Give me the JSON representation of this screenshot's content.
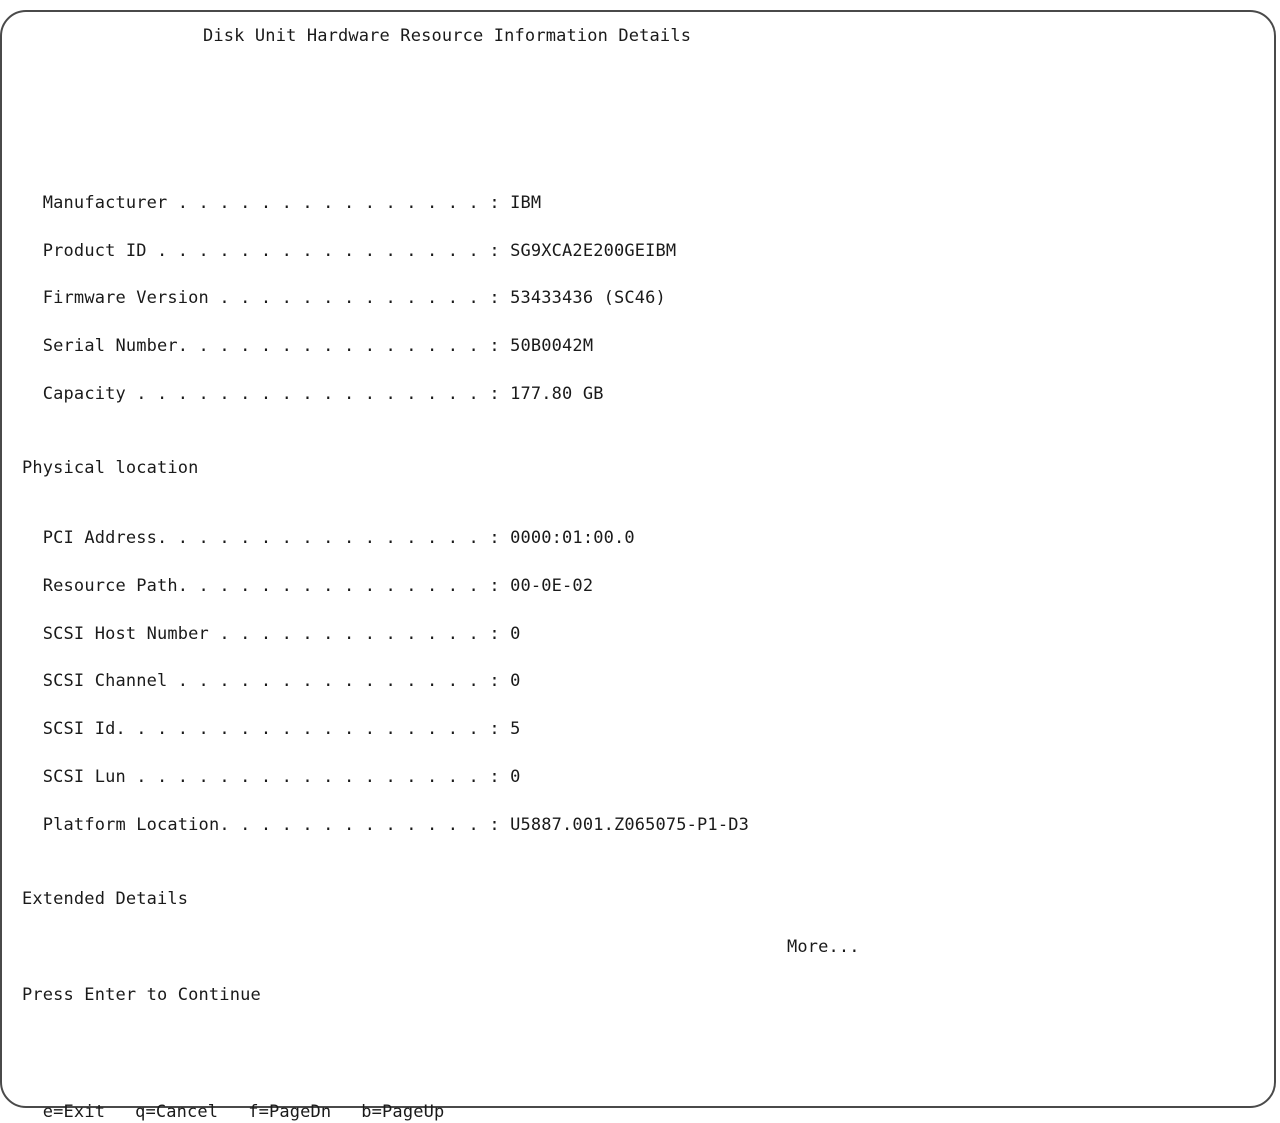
{
  "screen": {
    "title": "Disk Unit Hardware Resource Information Details",
    "device_info": [
      {
        "label": "Manufacturer . . . . . . . . . . . . . . . ",
        "sep": ": ",
        "value": "IBM"
      },
      {
        "label": "Product ID . . . . . . . . . . . . . . . . ",
        "sep": ": ",
        "value": "SG9XCA2E200GEIBM"
      },
      {
        "label": "Firmware Version . . . . . . . . . . . . . ",
        "sep": ": ",
        "value": "53433436 (SC46)"
      },
      {
        "label": "Serial Number. . . . . . . . . . . . . . . ",
        "sep": ": ",
        "value": "50B0042M"
      },
      {
        "label": "Capacity . . . . . . . . . . . . . . . . . ",
        "sep": ": ",
        "value": "177.80 GB"
      }
    ],
    "physical_location_heading": "Physical location",
    "location_info": [
      {
        "label": "PCI Address. . . . . . . . . . . . . . . . ",
        "sep": ": ",
        "value": "0000:01:00.0"
      },
      {
        "label": "Resource Path. . . . . . . . . . . . . . . ",
        "sep": ": ",
        "value": "00-0E-02"
      },
      {
        "label": "SCSI Host Number . . . . . . . . . . . . . ",
        "sep": ": ",
        "value": "0"
      },
      {
        "label": "SCSI Channel . . . . . . . . . . . . . . . ",
        "sep": ": ",
        "value": "0"
      },
      {
        "label": "SCSI Id. . . . . . . . . . . . . . . . . . ",
        "sep": ": ",
        "value": "5"
      },
      {
        "label": "SCSI Lun . . . . . . . . . . . . . . . . . ",
        "sep": ": ",
        "value": "0"
      },
      {
        "label": "Platform Location. . . . . . . . . . . . . ",
        "sep": ": ",
        "value": "U5887.001.Z065075-P1-D3"
      }
    ],
    "extended_details_heading": "Extended Details",
    "more_indicator": "More...",
    "prompt": "Press Enter to Continue",
    "function_keys": [
      "e=Exit",
      "q=Cancel",
      "f=PageDn",
      "b=PageUp"
    ]
  }
}
